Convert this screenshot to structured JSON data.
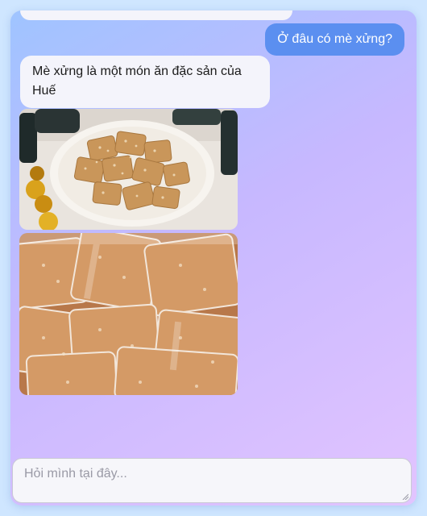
{
  "chat": {
    "messages": [
      {
        "role": "user",
        "text": "Ở đâu có mè xửng?"
      },
      {
        "role": "bot",
        "text": "Mè xửng là một món ăn đặc sản của Huế"
      }
    ],
    "images": [
      {
        "alt": ""
      },
      {
        "alt": ""
      }
    ]
  },
  "input": {
    "placeholder": "Hỏi mình tại đây...",
    "value": ""
  },
  "colors": {
    "user_bubble": "#5b8ff0",
    "bot_bubble": "#f4f4fb",
    "background_start": "#9fc4ff",
    "background_end": "#e2c4ff"
  }
}
